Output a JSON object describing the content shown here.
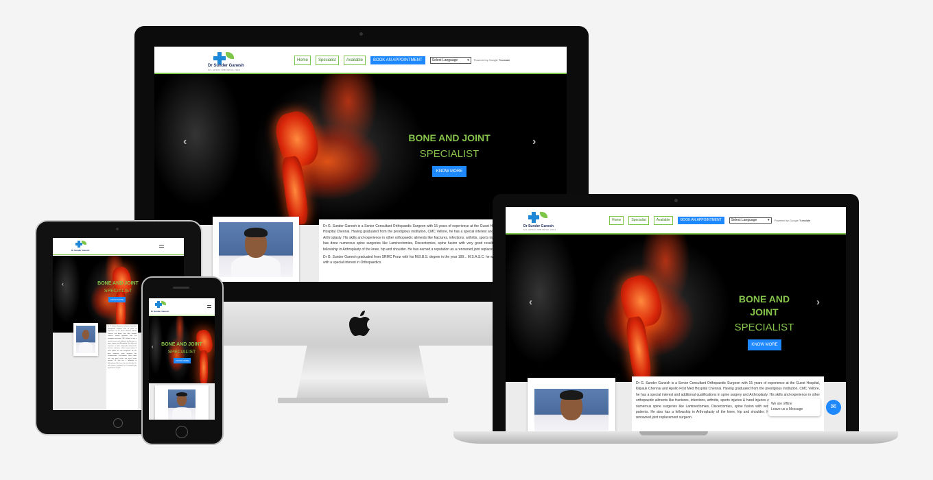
{
  "site": {
    "logo_title": "Dr Sunder Ganesh",
    "logo_subtitle": "M.S. ORTHO, DNB ORTHO, FRCS",
    "nav": {
      "home": "Home",
      "specialist": "Specialist",
      "available": "Available"
    },
    "appointment_button": "BOOK AN APPOINTMENT",
    "language_select": "Select Language",
    "powered_by": "Powered by Google",
    "translate": "Translate"
  },
  "hero": {
    "title_line1": "BONE AND JOINT",
    "title_laptop_line1": "BONE AND",
    "title_laptop_line2": "JOINT",
    "title_line2": "SPECIALIST",
    "button": "KNOW MORE",
    "prev_arrow": "‹",
    "next_arrow": "›"
  },
  "about": {
    "para1": "Dr G. Sunder Ganesh is a Senior Consultant Orthopaedic Surgeon with 15 years of experience at the Guest Hospital, Kilpauk Chennai and Apollo First Med Hospital Chennai. Having graduated from the prestigious institution, CMC Vellore, he has a special interest and additional qualifications in spine surgery and Arthroplasty. His skills and experience in other orthopaedic ailments like fractures, infections, arthritis, sports injuries & hand injuries are also exceptional. He has done numerous spine surgeries like Laminectomies, Discectomies, spine fusion with very good results and many happy patients. He also has a fellowship in Arthroplasty of the knee, hip and shoulder. He has earned a reputation as a renowned joint replacement surgeon.",
    "para2": "Dr G. Sunder Ganesh graduated from SRMC Porur with his M.B.B.S. degree in the year 199... M.S.A.S.C. he worked in various hospitals as a Medical officer with a special interest in Orthopaedics."
  },
  "chat": {
    "status": "We are offline",
    "prompt": "Leave us a Message"
  },
  "icons": {
    "apple": "apple-logo-icon",
    "chat": "chat-icon",
    "menu": "hamburger-menu-icon"
  },
  "colors": {
    "accent_green": "#7dc64a",
    "button_blue": "#1e88ff",
    "logo_blue": "#1e88d6"
  }
}
